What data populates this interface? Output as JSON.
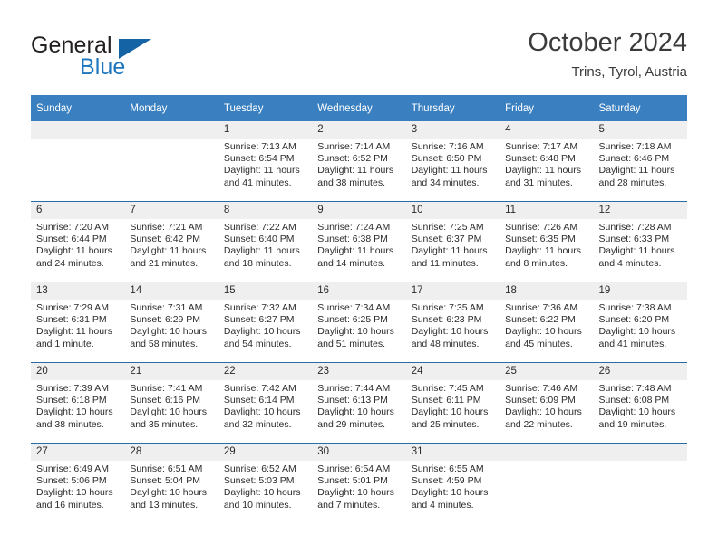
{
  "brand": {
    "name_part1": "General",
    "name_part2": "Blue"
  },
  "header": {
    "month_title": "October 2024",
    "location": "Trins, Tyrol, Austria"
  },
  "colors": {
    "header_blue": "#3a80c1",
    "rule_blue": "#2a6ca8",
    "daynum_band": "#efefef",
    "logo_blue": "#1d76bd",
    "text": "#2b2b2b"
  },
  "weekday_headers": [
    "Sunday",
    "Monday",
    "Tuesday",
    "Wednesday",
    "Thursday",
    "Friday",
    "Saturday"
  ],
  "weeks": [
    [
      {
        "day": "",
        "empty": true,
        "sunrise": "",
        "sunset": "",
        "daylight_line1": "",
        "daylight_line2": ""
      },
      {
        "day": "",
        "empty": true,
        "sunrise": "",
        "sunset": "",
        "daylight_line1": "",
        "daylight_line2": ""
      },
      {
        "day": "1",
        "sunrise": "Sunrise: 7:13 AM",
        "sunset": "Sunset: 6:54 PM",
        "daylight_line1": "Daylight: 11 hours",
        "daylight_line2": "and 41 minutes."
      },
      {
        "day": "2",
        "sunrise": "Sunrise: 7:14 AM",
        "sunset": "Sunset: 6:52 PM",
        "daylight_line1": "Daylight: 11 hours",
        "daylight_line2": "and 38 minutes."
      },
      {
        "day": "3",
        "sunrise": "Sunrise: 7:16 AM",
        "sunset": "Sunset: 6:50 PM",
        "daylight_line1": "Daylight: 11 hours",
        "daylight_line2": "and 34 minutes."
      },
      {
        "day": "4",
        "sunrise": "Sunrise: 7:17 AM",
        "sunset": "Sunset: 6:48 PM",
        "daylight_line1": "Daylight: 11 hours",
        "daylight_line2": "and 31 minutes."
      },
      {
        "day": "5",
        "sunrise": "Sunrise: 7:18 AM",
        "sunset": "Sunset: 6:46 PM",
        "daylight_line1": "Daylight: 11 hours",
        "daylight_line2": "and 28 minutes."
      }
    ],
    [
      {
        "day": "6",
        "sunrise": "Sunrise: 7:20 AM",
        "sunset": "Sunset: 6:44 PM",
        "daylight_line1": "Daylight: 11 hours",
        "daylight_line2": "and 24 minutes."
      },
      {
        "day": "7",
        "sunrise": "Sunrise: 7:21 AM",
        "sunset": "Sunset: 6:42 PM",
        "daylight_line1": "Daylight: 11 hours",
        "daylight_line2": "and 21 minutes."
      },
      {
        "day": "8",
        "sunrise": "Sunrise: 7:22 AM",
        "sunset": "Sunset: 6:40 PM",
        "daylight_line1": "Daylight: 11 hours",
        "daylight_line2": "and 18 minutes."
      },
      {
        "day": "9",
        "sunrise": "Sunrise: 7:24 AM",
        "sunset": "Sunset: 6:38 PM",
        "daylight_line1": "Daylight: 11 hours",
        "daylight_line2": "and 14 minutes."
      },
      {
        "day": "10",
        "sunrise": "Sunrise: 7:25 AM",
        "sunset": "Sunset: 6:37 PM",
        "daylight_line1": "Daylight: 11 hours",
        "daylight_line2": "and 11 minutes."
      },
      {
        "day": "11",
        "sunrise": "Sunrise: 7:26 AM",
        "sunset": "Sunset: 6:35 PM",
        "daylight_line1": "Daylight: 11 hours",
        "daylight_line2": "and 8 minutes."
      },
      {
        "day": "12",
        "sunrise": "Sunrise: 7:28 AM",
        "sunset": "Sunset: 6:33 PM",
        "daylight_line1": "Daylight: 11 hours",
        "daylight_line2": "and 4 minutes."
      }
    ],
    [
      {
        "day": "13",
        "sunrise": "Sunrise: 7:29 AM",
        "sunset": "Sunset: 6:31 PM",
        "daylight_line1": "Daylight: 11 hours",
        "daylight_line2": "and 1 minute."
      },
      {
        "day": "14",
        "sunrise": "Sunrise: 7:31 AM",
        "sunset": "Sunset: 6:29 PM",
        "daylight_line1": "Daylight: 10 hours",
        "daylight_line2": "and 58 minutes."
      },
      {
        "day": "15",
        "sunrise": "Sunrise: 7:32 AM",
        "sunset": "Sunset: 6:27 PM",
        "daylight_line1": "Daylight: 10 hours",
        "daylight_line2": "and 54 minutes."
      },
      {
        "day": "16",
        "sunrise": "Sunrise: 7:34 AM",
        "sunset": "Sunset: 6:25 PM",
        "daylight_line1": "Daylight: 10 hours",
        "daylight_line2": "and 51 minutes."
      },
      {
        "day": "17",
        "sunrise": "Sunrise: 7:35 AM",
        "sunset": "Sunset: 6:23 PM",
        "daylight_line1": "Daylight: 10 hours",
        "daylight_line2": "and 48 minutes."
      },
      {
        "day": "18",
        "sunrise": "Sunrise: 7:36 AM",
        "sunset": "Sunset: 6:22 PM",
        "daylight_line1": "Daylight: 10 hours",
        "daylight_line2": "and 45 minutes."
      },
      {
        "day": "19",
        "sunrise": "Sunrise: 7:38 AM",
        "sunset": "Sunset: 6:20 PM",
        "daylight_line1": "Daylight: 10 hours",
        "daylight_line2": "and 41 minutes."
      }
    ],
    [
      {
        "day": "20",
        "sunrise": "Sunrise: 7:39 AM",
        "sunset": "Sunset: 6:18 PM",
        "daylight_line1": "Daylight: 10 hours",
        "daylight_line2": "and 38 minutes."
      },
      {
        "day": "21",
        "sunrise": "Sunrise: 7:41 AM",
        "sunset": "Sunset: 6:16 PM",
        "daylight_line1": "Daylight: 10 hours",
        "daylight_line2": "and 35 minutes."
      },
      {
        "day": "22",
        "sunrise": "Sunrise: 7:42 AM",
        "sunset": "Sunset: 6:14 PM",
        "daylight_line1": "Daylight: 10 hours",
        "daylight_line2": "and 32 minutes."
      },
      {
        "day": "23",
        "sunrise": "Sunrise: 7:44 AM",
        "sunset": "Sunset: 6:13 PM",
        "daylight_line1": "Daylight: 10 hours",
        "daylight_line2": "and 29 minutes."
      },
      {
        "day": "24",
        "sunrise": "Sunrise: 7:45 AM",
        "sunset": "Sunset: 6:11 PM",
        "daylight_line1": "Daylight: 10 hours",
        "daylight_line2": "and 25 minutes."
      },
      {
        "day": "25",
        "sunrise": "Sunrise: 7:46 AM",
        "sunset": "Sunset: 6:09 PM",
        "daylight_line1": "Daylight: 10 hours",
        "daylight_line2": "and 22 minutes."
      },
      {
        "day": "26",
        "sunrise": "Sunrise: 7:48 AM",
        "sunset": "Sunset: 6:08 PM",
        "daylight_line1": "Daylight: 10 hours",
        "daylight_line2": "and 19 minutes."
      }
    ],
    [
      {
        "day": "27",
        "sunrise": "Sunrise: 6:49 AM",
        "sunset": "Sunset: 5:06 PM",
        "daylight_line1": "Daylight: 10 hours",
        "daylight_line2": "and 16 minutes."
      },
      {
        "day": "28",
        "sunrise": "Sunrise: 6:51 AM",
        "sunset": "Sunset: 5:04 PM",
        "daylight_line1": "Daylight: 10 hours",
        "daylight_line2": "and 13 minutes."
      },
      {
        "day": "29",
        "sunrise": "Sunrise: 6:52 AM",
        "sunset": "Sunset: 5:03 PM",
        "daylight_line1": "Daylight: 10 hours",
        "daylight_line2": "and 10 minutes."
      },
      {
        "day": "30",
        "sunrise": "Sunrise: 6:54 AM",
        "sunset": "Sunset: 5:01 PM",
        "daylight_line1": "Daylight: 10 hours",
        "daylight_line2": "and 7 minutes."
      },
      {
        "day": "31",
        "sunrise": "Sunrise: 6:55 AM",
        "sunset": "Sunset: 4:59 PM",
        "daylight_line1": "Daylight: 10 hours",
        "daylight_line2": "and 4 minutes."
      },
      {
        "day": "",
        "empty": true,
        "sunrise": "",
        "sunset": "",
        "daylight_line1": "",
        "daylight_line2": ""
      },
      {
        "day": "",
        "empty": true,
        "sunrise": "",
        "sunset": "",
        "daylight_line1": "",
        "daylight_line2": ""
      }
    ]
  ]
}
